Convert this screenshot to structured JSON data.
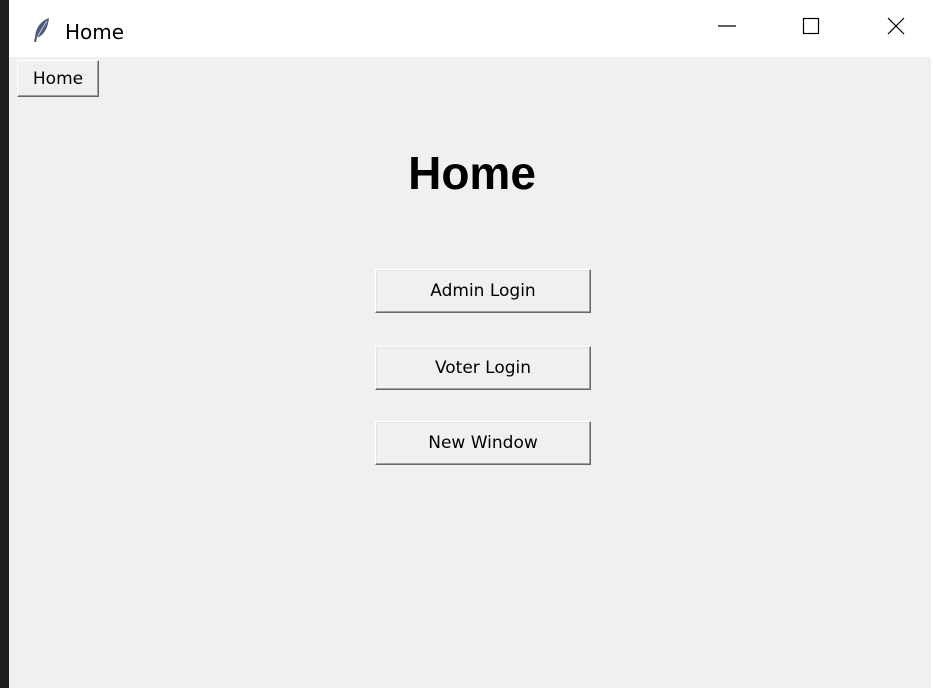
{
  "window": {
    "title": "Home",
    "app_icon": "feather-icon"
  },
  "controls": {
    "minimize_icon": "minimize-icon",
    "maximize_icon": "maximize-icon",
    "close_icon": "close-icon"
  },
  "menu": {
    "home_label": "Home"
  },
  "main": {
    "heading": "Home",
    "buttons": [
      {
        "label": "Admin Login"
      },
      {
        "label": "Voter Login"
      },
      {
        "label": "New Window"
      }
    ]
  }
}
